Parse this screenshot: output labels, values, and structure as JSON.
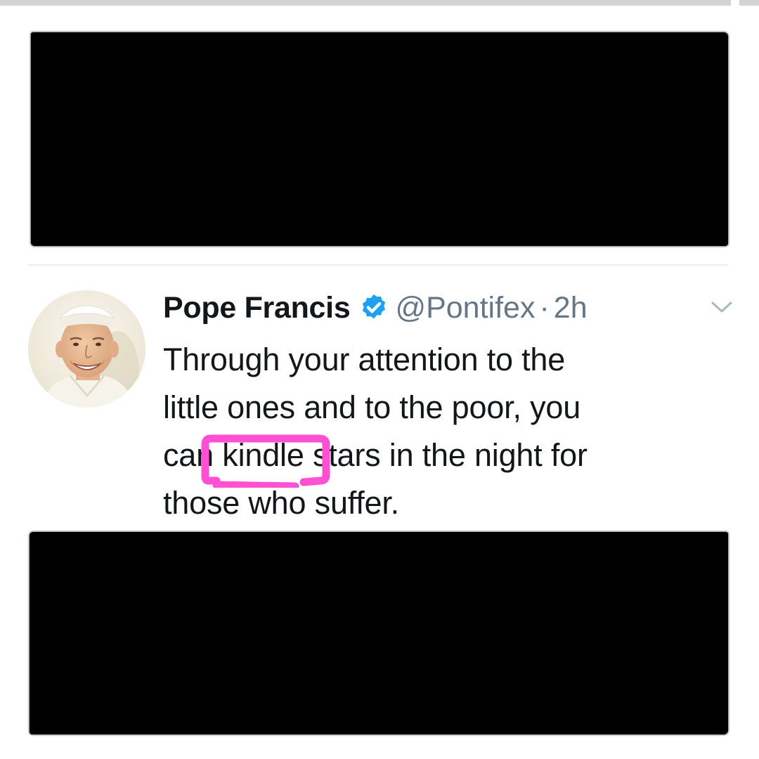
{
  "tweet": {
    "display_name": "Pope Francis",
    "verified": true,
    "handle": "@Pontifex",
    "separator": "·",
    "timestamp": "2h",
    "text_lines": {
      "line1": "Through your attention to the",
      "line2": "little ones and to the poor, you",
      "line3_before": "can ",
      "line3_highlight": "kindle",
      "line3_after": " stars in the night for",
      "line4": "those who suffer."
    },
    "avatar_icon": "pope-portrait-avatar",
    "menu_icon": "chevron-down-icon"
  },
  "annotation": {
    "highlighted_word": "kindle",
    "highlight_color": "#ff4fd2"
  },
  "redactions": {
    "count": 2,
    "color": "#000000"
  },
  "colors": {
    "name_text": "#14171a",
    "secondary_text": "#657786",
    "verified_badge": "#1da1f2"
  }
}
